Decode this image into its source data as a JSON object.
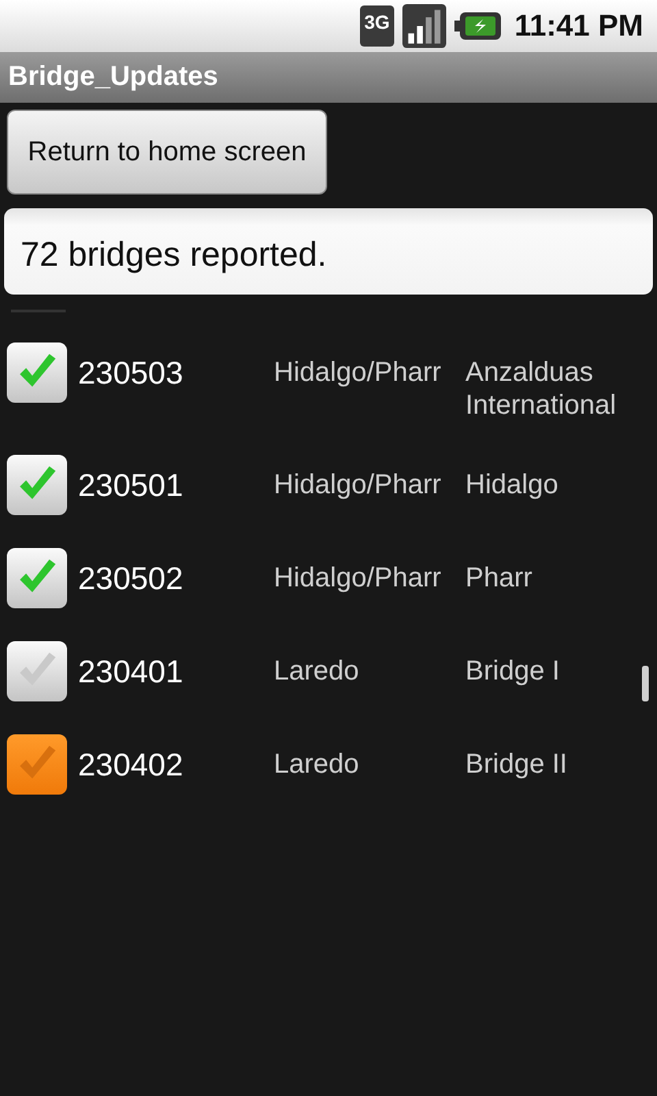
{
  "status_bar": {
    "network_type": "3G",
    "time": "11:41 PM"
  },
  "window": {
    "title": "Bridge_Updates"
  },
  "home_button": {
    "label": "Return to home screen"
  },
  "summary": {
    "value": "72 bridges reported."
  },
  "bridges": [
    {
      "id": "230503",
      "city": "Hidalgo/Pharr",
      "name": "Anzalduas International",
      "checked": true,
      "selected": false
    },
    {
      "id": "230501",
      "city": "Hidalgo/Pharr",
      "name": "Hidalgo",
      "checked": true,
      "selected": false
    },
    {
      "id": "230502",
      "city": "Hidalgo/Pharr",
      "name": "Pharr",
      "checked": true,
      "selected": false
    },
    {
      "id": "230401",
      "city": "Laredo",
      "name": "Bridge I",
      "checked": false,
      "selected": false
    },
    {
      "id": "230402",
      "city": "Laredo",
      "name": "Bridge II",
      "checked": false,
      "selected": true
    }
  ]
}
